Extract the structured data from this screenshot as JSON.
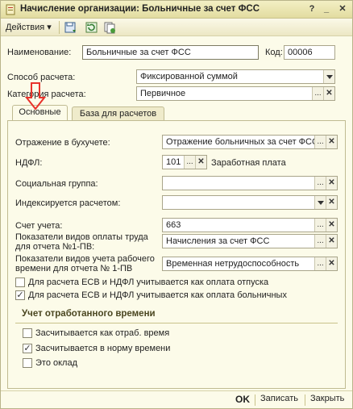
{
  "window": {
    "title": "Начисление организации: Больничные за счет ФСС"
  },
  "toolbar": {
    "actions_label": "Действия",
    "dropdown_arrow": "▾"
  },
  "form": {
    "name_label": "Наименование:",
    "name_value": "Больничные за счет ФСС",
    "code_label": "Код:",
    "code_value": "00006",
    "method_label": "Способ расчета:",
    "method_value": "Фиксированной суммой",
    "category_label": "Категория расчета:",
    "category_value": "Первичное"
  },
  "tabs": [
    {
      "label": "Основные",
      "active": true
    },
    {
      "label": "База для расчетов",
      "active": false
    }
  ],
  "main": {
    "accounting_label": "Отражение в бухучете:",
    "accounting_value": "Отражение больничных за счет ФСС",
    "ndfl_label": "НДФЛ:",
    "ndfl_value": "101",
    "ndfl_desc": "Заработная плата",
    "social_label": "Социальная группа:",
    "social_value": "",
    "indexed_label": "Индексируется расчетом:",
    "indexed_value": "",
    "account_label": "Счет учета:",
    "account_value": "663",
    "pay_label_1": "Показатели видов оплаты труда",
    "pay_label_2": "для отчета №1-ПВ:",
    "pay_value": "Начисления за счет ФСС",
    "time_label_1": "Показатели видов учета рабочего",
    "time_label_2": "времени для отчета № 1-ПВ",
    "time_value": "Временная нетрудоспособность",
    "checks": [
      {
        "label": "Для расчета ЕСВ и НДФЛ учитывается как оплата отпуска",
        "checked": false
      },
      {
        "label": "Для расчета ЕСВ и НДФЛ учитывается как оплата больничных",
        "checked": true
      }
    ],
    "worktime_title": "Учет отработанного времени",
    "worktime_checks": [
      {
        "label": "Засчитывается как отраб. время",
        "checked": false
      },
      {
        "label": "Засчитывается в норму времени",
        "checked": true
      },
      {
        "label": "Это оклад",
        "checked": false
      }
    ]
  },
  "footer": {
    "ok": "OK",
    "save": "Записать",
    "close": "Закрыть"
  },
  "glyphs": {
    "ellipsis": "...",
    "clear": "✕",
    "check": "✓",
    "close": "✕",
    "help": "?",
    "minimize": "_"
  },
  "colors": {
    "background": "#fcfbe9",
    "titlebar": "#e2dca0",
    "annotation_arrow": "#e8322a"
  }
}
